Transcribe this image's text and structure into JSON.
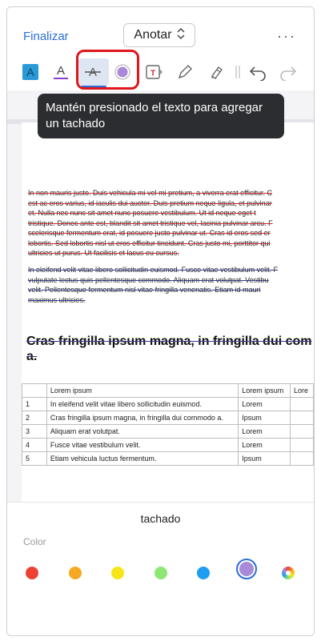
{
  "topbar": {
    "done_label": "Finalizar",
    "mode_label": "Anotar",
    "more_label": "···"
  },
  "toolbar": {
    "tools": [
      {
        "name": "highlight-text-tool"
      },
      {
        "name": "underline-text-tool"
      },
      {
        "name": "strikethrough-text-tool"
      },
      {
        "name": "color-picker-tool"
      },
      {
        "name": "text-box-tool"
      },
      {
        "name": "pencil-tool"
      },
      {
        "name": "marker-tool"
      },
      {
        "name": "undo-tool"
      },
      {
        "name": "redo-tool"
      }
    ],
    "selected": "strikethrough-text-tool",
    "accent_color": "#2a6fd6",
    "highlight_box_color": "#e0161c"
  },
  "tooltip": {
    "text": "Mantén presionado el texto para agregar un tachado"
  },
  "document": {
    "para1": "In non mauris justo. Duis vehicula mi vel mi pretium, a viverra erat efficitur. C\nest ac eros varius, id iaculis dui auctor. Duis pretium neque ligula, et pulvinar\net. Nulla nec nunc sit amet nunc posuere vestibulum. Ut id neque eget t\ntristique. Donec ante est, blandit sit amet tristique vel, lacinia pulvinar arcu. F\nscelerisque fermentum erat, id posuere justo pulvinar ut. Cras id eros sed er\nlobortis. Sed lobortis nisl ut eros efficitur tincidunt. Cras justo mi, porttitor qui\nultricies ut purus. Ut facilisis et lacus eu cursus.",
    "para2": "In eleifend velit vitae libero sollicitudin euismod. Fusce vitae vestibulum velit. F\nvulputate lectus quis pellentesque commodo. Aliquam erat volutpat. Vestibu\nvelit. Pellentesque fermentum nisl vitae fringilla venenatis. Etiam id mauri\nmaximus ultricies.",
    "heading": "Cras fringilla ipsum magna, in fringilla dui com",
    "heading_cont": "a.",
    "table": [
      [
        "",
        "Lorem ipsum",
        "Lorem ipsum",
        "Lore"
      ],
      [
        "1",
        "In eleifend velit vitae libero sollicitudin euismod.",
        "Lorem",
        ""
      ],
      [
        "2",
        "Cras fringilla ipsum magna, in fringilla dui commodo a.",
        "Ipsum",
        ""
      ],
      [
        "3",
        "Aliquam erat volutpat.",
        "Lorem",
        ""
      ],
      [
        "4",
        "Fusce vitae vestibulum velit.",
        "Lorem",
        ""
      ],
      [
        "5",
        "Etiam vehicula luctus fermentum.",
        "Ipsum",
        ""
      ]
    ]
  },
  "sheet": {
    "title": "tachado",
    "color_label": "Color",
    "colors": [
      {
        "name": "red",
        "hex": "#ee4136"
      },
      {
        "name": "orange",
        "hex": "#f7a823"
      },
      {
        "name": "yellow",
        "hex": "#f7e617"
      },
      {
        "name": "green",
        "hex": "#8ee673"
      },
      {
        "name": "blue",
        "hex": "#1e9ef0"
      },
      {
        "name": "purple",
        "hex": "#a98ad9"
      },
      {
        "name": "multicolor",
        "hex": "multicolor"
      }
    ],
    "selected_color": "purple"
  }
}
